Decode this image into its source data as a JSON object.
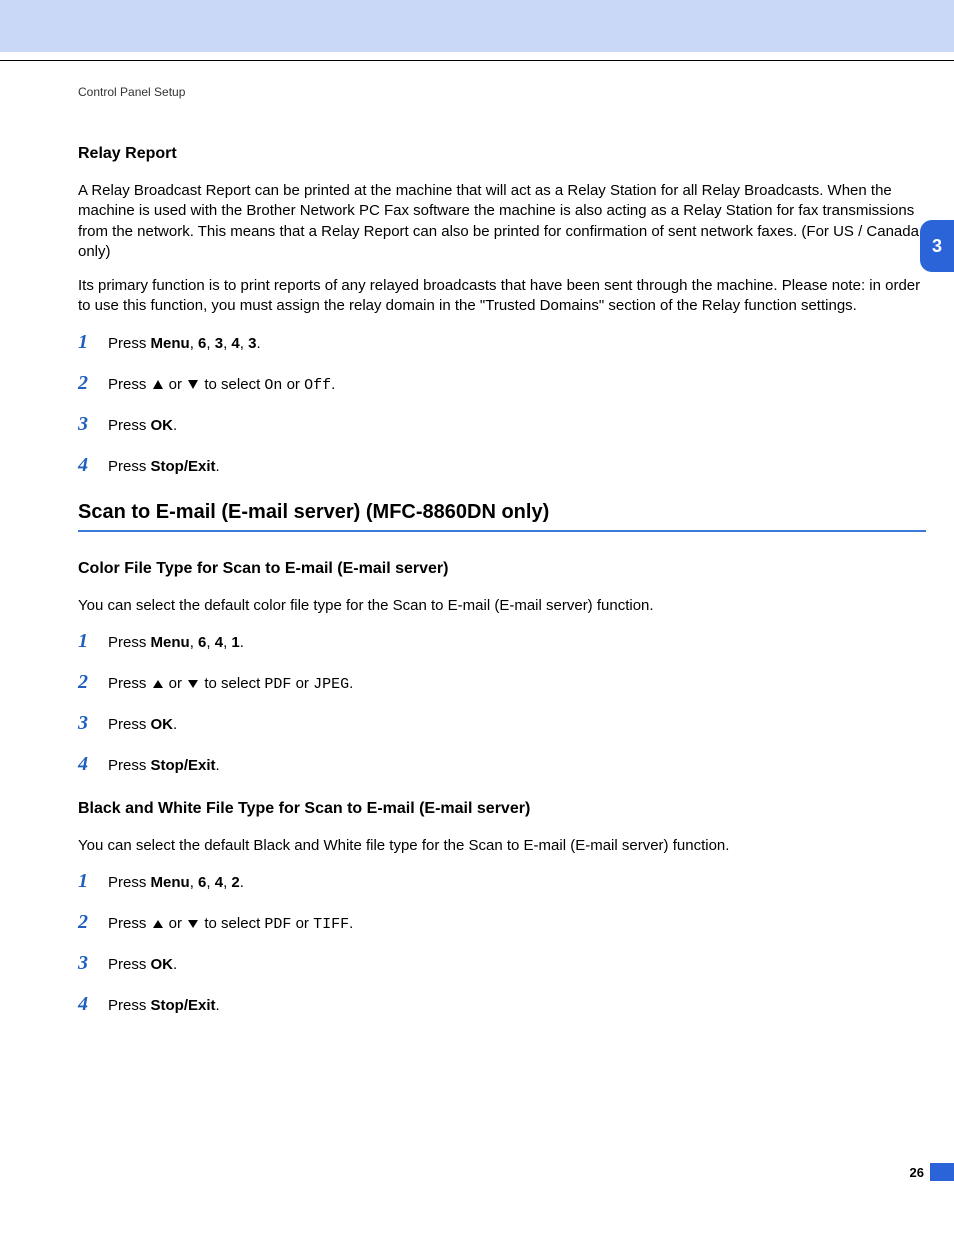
{
  "doc_header": "Control Panel Setup",
  "chapter_tab": "3",
  "page_number": "26",
  "relay": {
    "title": "Relay Report",
    "para1": "A Relay Broadcast Report can be printed at the machine that will act as a Relay Station for all Relay Broadcasts. When the machine is used with the Brother Network PC Fax software the machine is also acting as a Relay Station for fax transmissions from the network. This means that a Relay Report can also be printed for confirmation of sent network faxes. (For US / Canada only)",
    "para2": "Its primary function is to print reports of any relayed broadcasts that have been sent through the machine. Please note: in order to use this function, you must assign the relay domain in the \"Trusted Domains\" section of the Relay function settings.",
    "steps": {
      "s1_a": "Press ",
      "s1_menu": "Menu",
      "s1_b": ", ",
      "s1_n1": "6",
      "s1_c": ", ",
      "s1_n2": "3",
      "s1_d": ", ",
      "s1_n3": "4",
      "s1_e": ", ",
      "s1_n4": "3",
      "s1_f": ".",
      "s2_a": "Press ",
      "s2_b": " or ",
      "s2_c": " to select ",
      "s2_on": "On",
      "s2_d": " or ",
      "s2_off": "Off",
      "s2_e": ".",
      "s3_a": "Press ",
      "s3_ok": "OK",
      "s3_b": ".",
      "s4_a": "Press ",
      "s4_stop": "Stop/Exit",
      "s4_b": "."
    }
  },
  "section_heading": "Scan to E-mail (E-mail server) (MFC-8860DN only)",
  "color": {
    "title": "Color File Type for Scan to E-mail (E-mail server)",
    "para": "You can select the default color file type for the Scan to E-mail (E-mail server) function.",
    "steps": {
      "s1_a": "Press ",
      "s1_menu": "Menu",
      "s1_b": ", ",
      "s1_n1": "6",
      "s1_c": ", ",
      "s1_n2": "4",
      "s1_d": ", ",
      "s1_n3": "1",
      "s1_e": ".",
      "s2_a": "Press ",
      "s2_b": " or ",
      "s2_c": " to select ",
      "s2_pdf": "PDF",
      "s2_d": " or ",
      "s2_jpeg": "JPEG",
      "s2_e": ".",
      "s3_a": "Press ",
      "s3_ok": "OK",
      "s3_b": ".",
      "s4_a": "Press ",
      "s4_stop": "Stop/Exit",
      "s4_b": "."
    }
  },
  "bw": {
    "title": "Black and White File Type for Scan to E-mail (E-mail server)",
    "para": "You can select the default Black and White file type for the Scan to E-mail (E-mail server) function.",
    "steps": {
      "s1_a": "Press ",
      "s1_menu": "Menu",
      "s1_b": ", ",
      "s1_n1": "6",
      "s1_c": ", ",
      "s1_n2": "4",
      "s1_d": ", ",
      "s1_n3": "2",
      "s1_e": ".",
      "s2_a": "Press ",
      "s2_b": " or ",
      "s2_c": " to select ",
      "s2_pdf": "PDF",
      "s2_d": " or ",
      "s2_tiff": "TIFF",
      "s2_e": ".",
      "s3_a": "Press ",
      "s3_ok": "OK",
      "s3_b": ".",
      "s4_a": "Press ",
      "s4_stop": "Stop/Exit",
      "s4_b": "."
    }
  }
}
